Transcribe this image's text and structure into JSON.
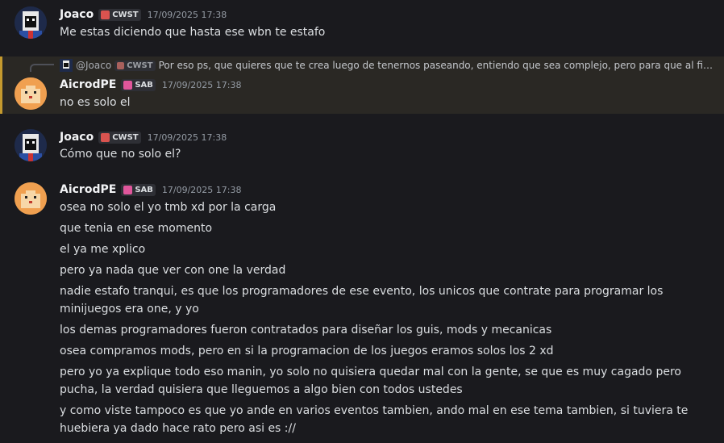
{
  "messages": [
    {
      "author": "Joaco",
      "tag": "CWST",
      "timestamp": "17/09/2025 17:38",
      "lines": [
        "Me estas diciendo que hasta ese wbn te estafo"
      ]
    },
    {
      "reply": {
        "name": "@Joaco",
        "tag": "CWST",
        "text": "Por eso ps, que quieres que te crea luego de tenernos paseando, entiendo que sea complejo, pero para que al fin..."
      },
      "author": "AicrodPE",
      "tag": "SAB",
      "timestamp": "17/09/2025 17:38",
      "lines": [
        "no es solo el"
      ]
    },
    {
      "author": "Joaco",
      "tag": "CWST",
      "timestamp": "17/09/2025 17:38",
      "lines": [
        "Cómo que no solo el?"
      ]
    },
    {
      "author": "AicrodPE",
      "tag": "SAB",
      "timestamp": "17/09/2025 17:38",
      "lines": [
        "osea no solo el yo tmb xd por la carga",
        "que tenia en ese momento",
        "el ya me xplico",
        "pero ya nada que ver con one la verdad",
        "nadie estafo tranqui, es que los programadores de ese evento, los unicos que contrate para programar los minijuegos era one, y yo",
        "los demas programadores fueron contratados para diseñar los guis, mods y mecanicas",
        "osea compramos mods, pero en si la programacion de los juegos eramos solos los 2 xd",
        "pero yo ya explique todo eso manin, yo solo no quisiera quedar mal con la gente, se que es muy cagado pero pucha, la verdad quisiera que lleguemos a algo bien con todos ustedes",
        "y como viste tampoco es que yo ande en varios eventos tambien, ando mal en ese tema tambien, si tuviera te huebiera ya dado hace rato pero asi es ://"
      ]
    }
  ],
  "colors": {
    "background": "#1a1a1e",
    "highlight": "#2a2824",
    "highlight_border": "#c59a2e",
    "cwst_icon": "#d9534f",
    "sab_icon": "#e0569b"
  }
}
